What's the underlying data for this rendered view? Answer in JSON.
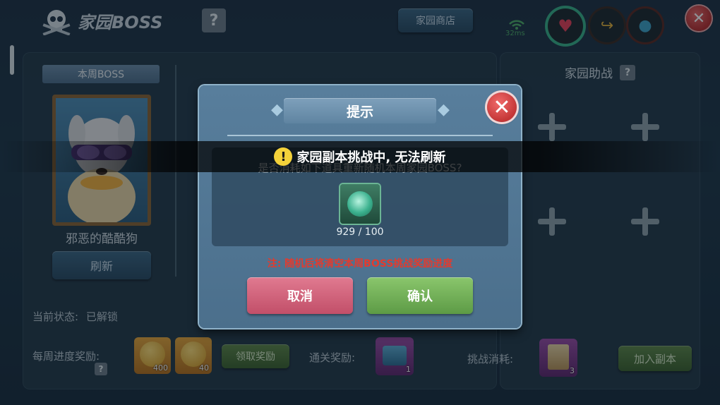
{
  "header": {
    "title": "家园BOSS",
    "help_label": "?",
    "shop_button": "家园商店",
    "ping": "32ms",
    "close_label": "✕"
  },
  "boss_panel": {
    "tab_label": "本周BOSS",
    "boss_name": "邪恶的酷酷狗",
    "refresh_button": "刷新"
  },
  "assist_panel": {
    "title": "家园助战",
    "help_label": "?"
  },
  "status": {
    "label": "当前状态:",
    "value": "已解锁"
  },
  "rewards": {
    "weekly_label": "每周进度奖励:",
    "help_label": "?",
    "coin_counts": [
      "400",
      "40"
    ],
    "claim_button": "领取奖励",
    "clear_label": "通关奖励:",
    "clear_count": "1",
    "cost_label": "挑战消耗:",
    "cost_count": "3",
    "join_button": "加入副本"
  },
  "modal": {
    "title": "提示",
    "close_label": "✕",
    "question": "是否消耗如下道具重新随机本周家园BOSS?",
    "item_count": "929 / 100",
    "note": "注: 随机后将清空本周BOSS挑战奖励进度",
    "cancel_button": "取消",
    "confirm_button": "确认"
  },
  "toast": {
    "icon": "!",
    "message": "家园副本挑战中, 无法刷新"
  },
  "colors": {
    "note_red": "#e23b2f",
    "confirm_green": "#5d9b46",
    "cancel_pink": "#c24f69"
  }
}
